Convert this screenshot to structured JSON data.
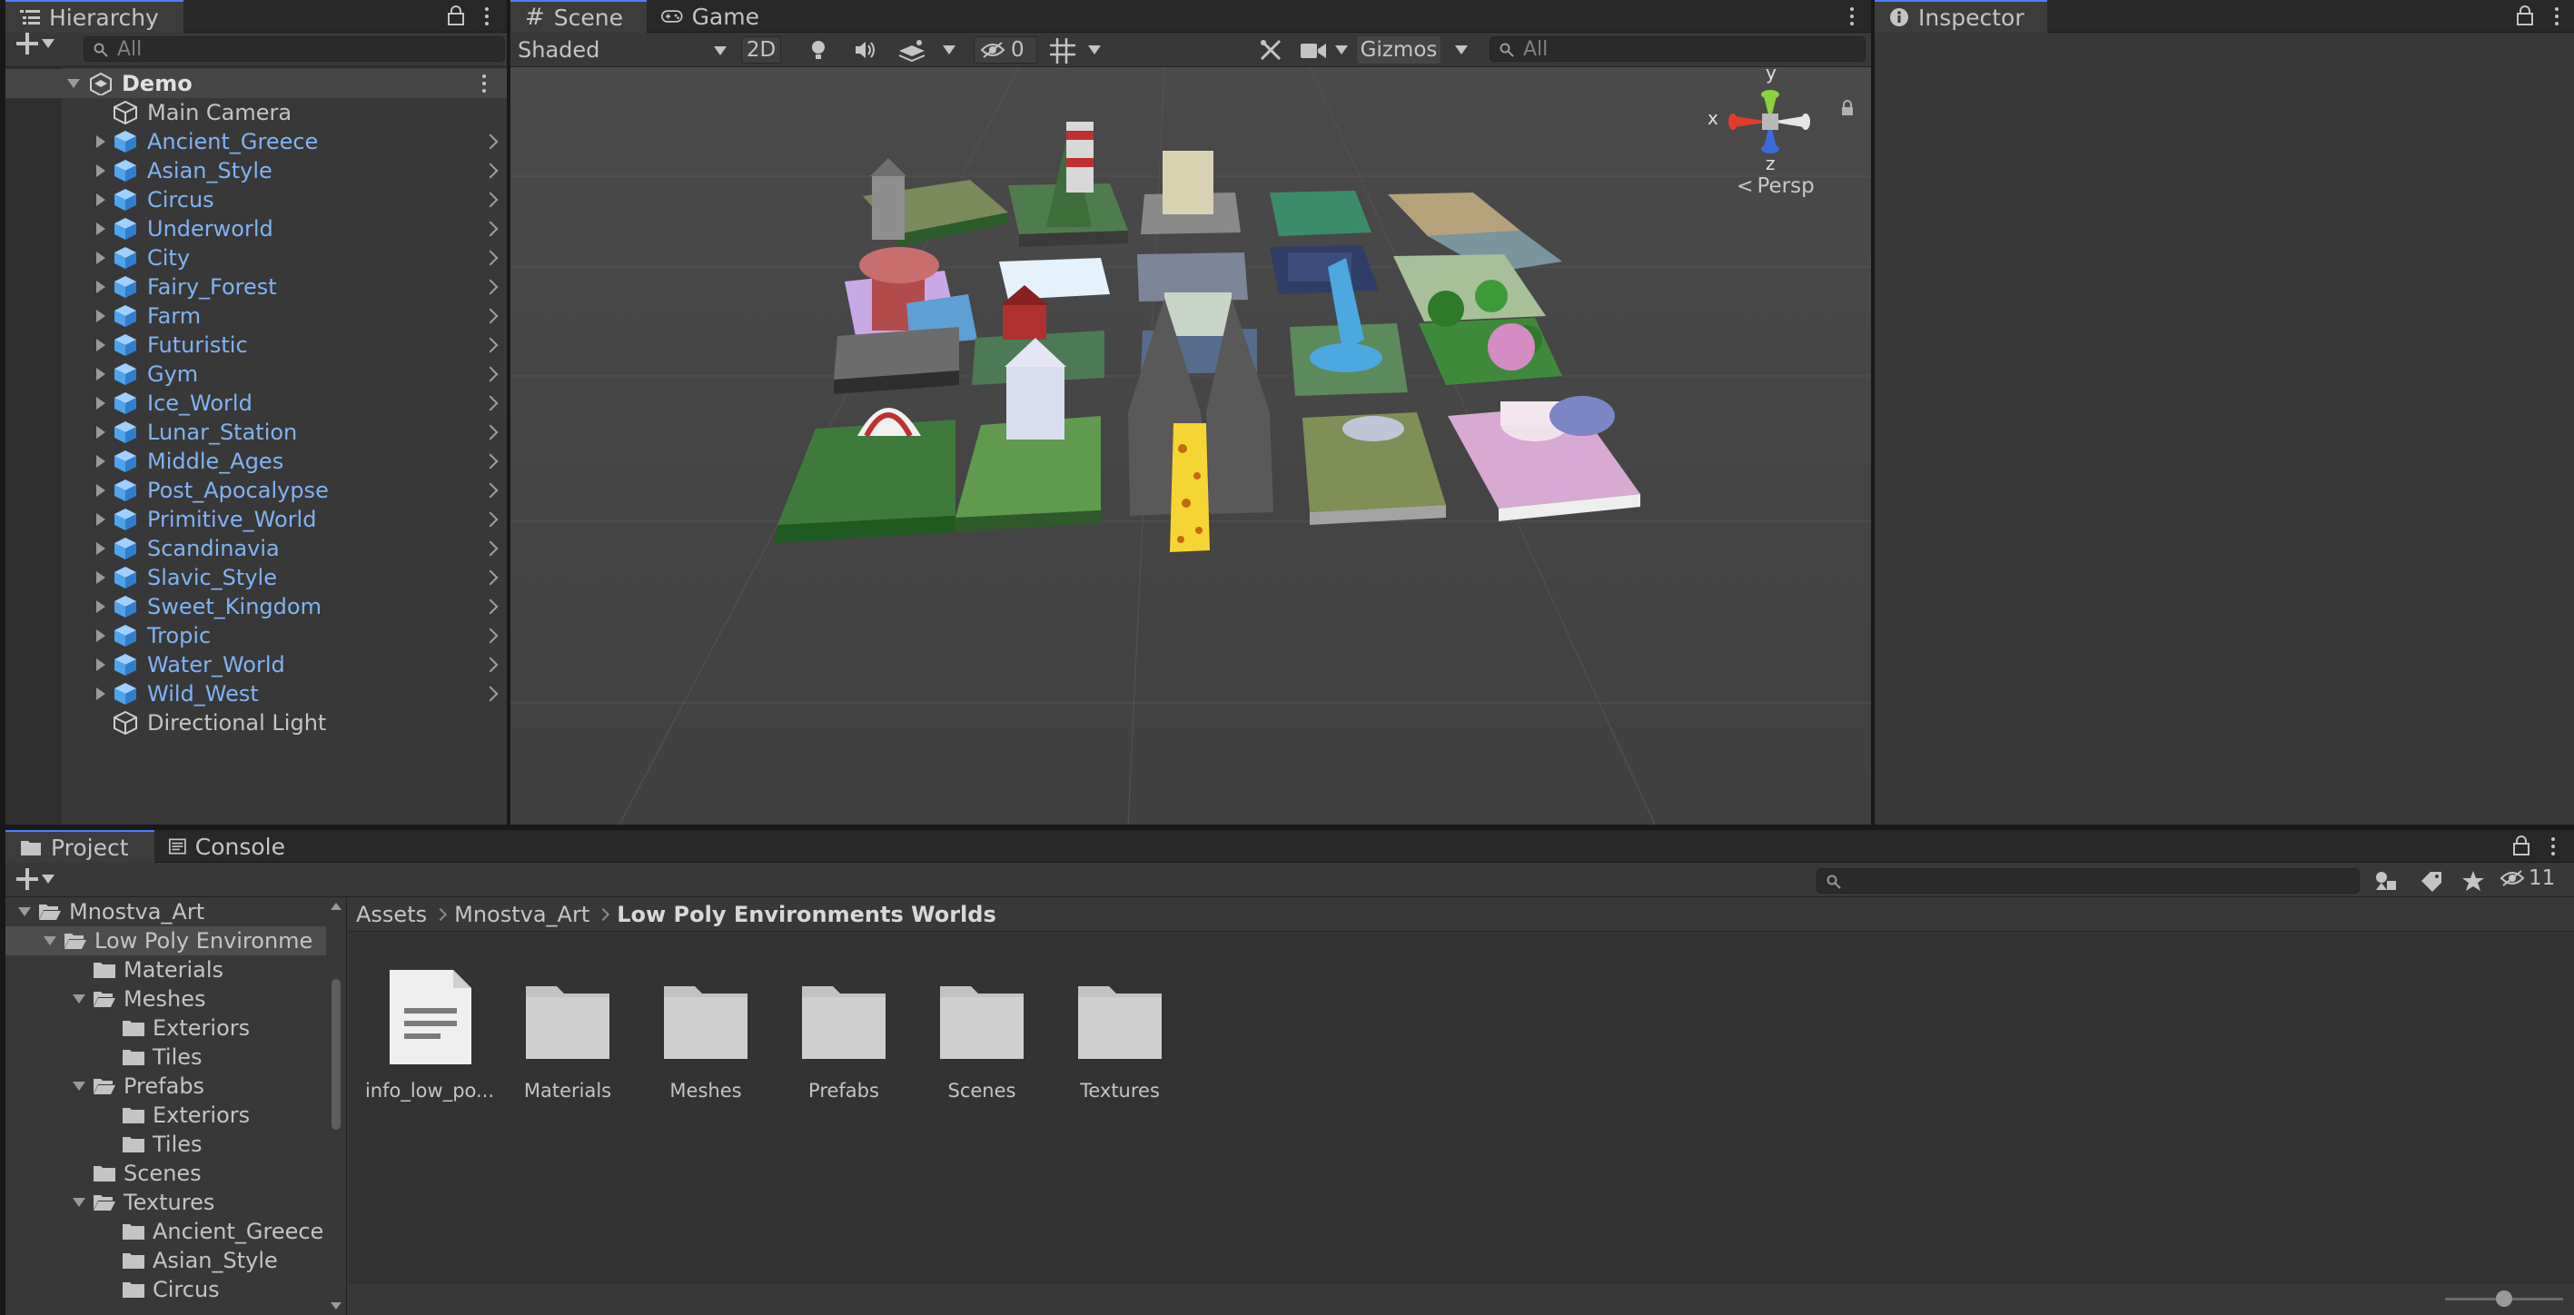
{
  "hierarchy": {
    "tab": "Hierarchy",
    "search_placeholder": "All",
    "scene_name": "Demo",
    "items": [
      {
        "label": "Main Camera",
        "type": "object"
      },
      {
        "label": "Ancient_Greece",
        "type": "prefab"
      },
      {
        "label": "Asian_Style",
        "type": "prefab"
      },
      {
        "label": "Circus",
        "type": "prefab"
      },
      {
        "label": "Underworld",
        "type": "prefab"
      },
      {
        "label": "City",
        "type": "prefab"
      },
      {
        "label": "Fairy_Forest",
        "type": "prefab"
      },
      {
        "label": "Farm",
        "type": "prefab"
      },
      {
        "label": "Futuristic",
        "type": "prefab"
      },
      {
        "label": "Gym",
        "type": "prefab"
      },
      {
        "label": "Ice_World",
        "type": "prefab"
      },
      {
        "label": "Lunar_Station",
        "type": "prefab"
      },
      {
        "label": "Middle_Ages",
        "type": "prefab"
      },
      {
        "label": "Post_Apocalypse",
        "type": "prefab"
      },
      {
        "label": "Primitive_World",
        "type": "prefab"
      },
      {
        "label": "Scandinavia",
        "type": "prefab"
      },
      {
        "label": "Slavic_Style",
        "type": "prefab"
      },
      {
        "label": "Sweet_Kingdom",
        "type": "prefab"
      },
      {
        "label": "Tropic",
        "type": "prefab"
      },
      {
        "label": "Water_World",
        "type": "prefab"
      },
      {
        "label": "Wild_West",
        "type": "prefab"
      },
      {
        "label": "Directional Light",
        "type": "object"
      }
    ]
  },
  "scene": {
    "tab_scene": "Scene",
    "tab_game": "Game",
    "shading_mode": "Shaded",
    "btn_2d": "2D",
    "hidden_count": "0",
    "gizmos_label": "Gizmos",
    "search_placeholder": "All",
    "gizmo_x": "x",
    "gizmo_y": "y",
    "gizmo_z": "z",
    "persp_label": "Persp"
  },
  "inspector": {
    "tab": "Inspector"
  },
  "project": {
    "tab_project": "Project",
    "tab_console": "Console",
    "hidden_count": "11",
    "breadcrumb": [
      "Assets",
      "Mnostva_Art",
      "Low Poly Environments Worlds"
    ],
    "tree": [
      {
        "label": "Mnostva_Art",
        "expanded": true
      },
      {
        "label": "Low Poly Environme",
        "expanded": true
      },
      {
        "label": "Materials",
        "expanded": false
      },
      {
        "label": "Meshes",
        "expanded": true
      },
      {
        "label": "Exteriors",
        "expanded": false
      },
      {
        "label": "Tiles",
        "expanded": false
      },
      {
        "label": "Prefabs",
        "expanded": true
      },
      {
        "label": "Exteriors",
        "expanded": false
      },
      {
        "label": "Tiles",
        "expanded": false
      },
      {
        "label": "Scenes",
        "expanded": false
      },
      {
        "label": "Textures",
        "expanded": true
      },
      {
        "label": "Ancient_Greece",
        "expanded": false
      },
      {
        "label": "Asian_Style",
        "expanded": false
      },
      {
        "label": "Circus",
        "expanded": false
      }
    ],
    "assets": [
      {
        "label": "info_low_po...",
        "kind": "document"
      },
      {
        "label": "Materials",
        "kind": "folder"
      },
      {
        "label": "Meshes",
        "kind": "folder"
      },
      {
        "label": "Prefabs",
        "kind": "folder"
      },
      {
        "label": "Scenes",
        "kind": "folder"
      },
      {
        "label": "Textures",
        "kind": "folder"
      }
    ]
  },
  "colors": {
    "accent": "#4c7eff",
    "prefab_text": "#7fb3f5",
    "panel_bg": "#383838",
    "tab_bg": "#282828"
  }
}
